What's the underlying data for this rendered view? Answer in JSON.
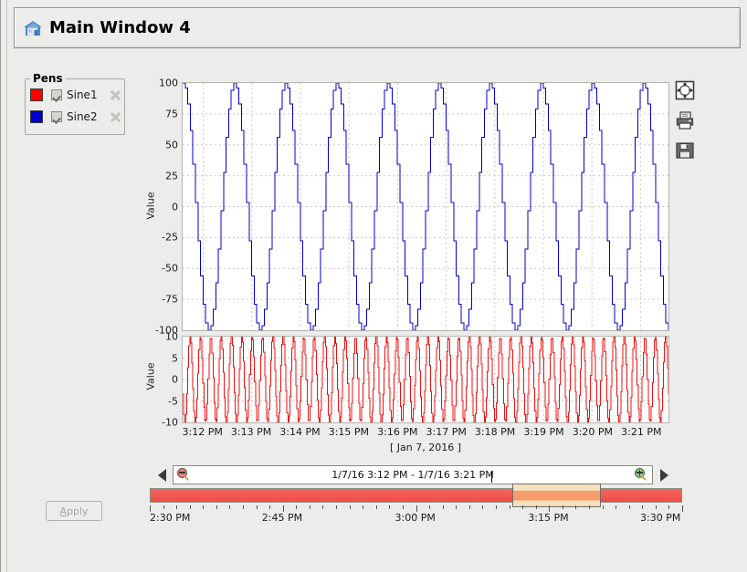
{
  "window": {
    "title": "Main Window 4",
    "icon": "home-icon"
  },
  "pens": {
    "legend_label": "Pens",
    "items": [
      {
        "label": "Sine1",
        "color": "#ff0000",
        "checked": true,
        "delete_icon": "close-x-icon"
      },
      {
        "label": "Sine2",
        "color": "#0000cc",
        "checked": true,
        "delete_icon": "close-x-icon"
      }
    ]
  },
  "chart_tools": [
    {
      "name": "fullscreen-icon",
      "label": "Fullscreen"
    },
    {
      "name": "print-icon",
      "label": "Print"
    },
    {
      "name": "save-icon",
      "label": "Save"
    }
  ],
  "chart_data": [
    {
      "type": "line",
      "id": "top-chart",
      "title": "",
      "xlabel": "",
      "ylabel": "Value",
      "ylim": [
        -100,
        100
      ],
      "yticks": [
        "100",
        "75",
        "50",
        "25",
        "0",
        "-25",
        "-50",
        "-75",
        "-100"
      ],
      "ytick_values": [
        100,
        75,
        50,
        25,
        0,
        -25,
        -50,
        -75,
        -100
      ],
      "xticks": [
        "3:12 PM",
        "3:13 PM",
        "3:14 PM",
        "3:15 PM",
        "3:16 PM",
        "3:17 PM",
        "3:18 PM",
        "3:19 PM",
        "3:20 PM",
        "3:21 PM"
      ],
      "grid": true,
      "legend": "Pens panel",
      "series": [
        {
          "name": "Sine2",
          "color": "#0000cc",
          "style": "step",
          "amplitude": 100,
          "offset": 0,
          "cycles": 9.5,
          "phase_deg": 88,
          "samples": 190
        }
      ]
    },
    {
      "type": "line",
      "id": "bottom-chart",
      "title": "",
      "xlabel": "",
      "ylabel": "Value",
      "ylim": [
        -10,
        10
      ],
      "yticks": [
        "10",
        "5",
        "0",
        "-5",
        "-10"
      ],
      "ytick_values": [
        10,
        5,
        0,
        -5,
        -10
      ],
      "xticks": [
        "3:12 PM",
        "3:13 PM",
        "3:14 PM",
        "3:15 PM",
        "3:16 PM",
        "3:17 PM",
        "3:18 PM",
        "3:19 PM",
        "3:20 PM",
        "3:21 PM"
      ],
      "grid": true,
      "series": [
        {
          "name": "Sine1",
          "color": "#ee1111",
          "style": "step",
          "amplitude": 10,
          "offset": 0,
          "cycles": 47,
          "phase_deg": 200,
          "samples": 480
        }
      ]
    }
  ],
  "axis": {
    "date_caption": "[ Jan 7, 2016 ]"
  },
  "range_nav": {
    "prev_label": "left-arrow",
    "next_label": "right-arrow",
    "zoom_out_icon": "zoom-out-icon",
    "zoom_in_icon": "zoom-in-icon",
    "range_text": "1/7/16 3:12 PM - 1/7/16 3:21 PM"
  },
  "timeline": {
    "start_label": "2:30 PM",
    "end_label": "3:30 PM",
    "labels": [
      "2:30 PM",
      "2:45 PM",
      "3:00 PM",
      "3:15 PM",
      "3:30 PM"
    ],
    "label_positions": [
      0,
      25,
      50,
      75,
      100
    ],
    "selection_start": "3:12 PM",
    "selection_end": "3:21 PM",
    "track_color": "#f0524b",
    "thumb_color": "#f79b6a"
  },
  "apply": {
    "label": "Apply",
    "mnemonic": "A",
    "rest": "pply",
    "enabled": false
  }
}
